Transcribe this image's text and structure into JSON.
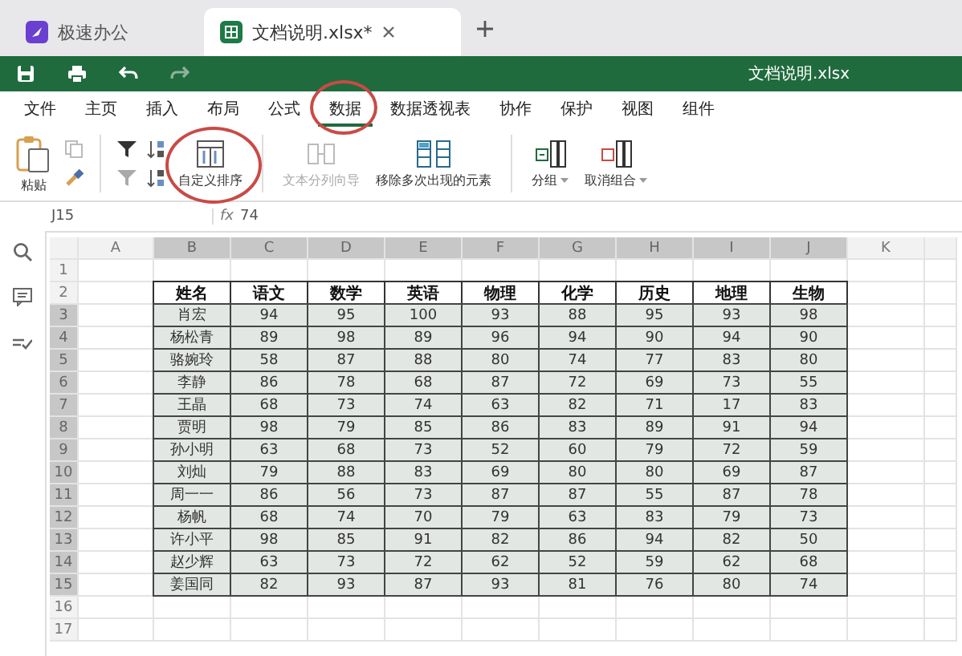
{
  "tabs": [
    {
      "label": "极速办公",
      "kind": "home",
      "selected": false
    },
    {
      "label": "文档说明.xlsx*",
      "kind": "sheet",
      "selected": true
    }
  ],
  "toolbar": {
    "title": "文档说明.xlsx"
  },
  "menu": [
    {
      "label": "文件",
      "selected": false,
      "circled": false
    },
    {
      "label": "主页",
      "selected": false,
      "circled": false
    },
    {
      "label": "插入",
      "selected": false,
      "circled": false
    },
    {
      "label": "布局",
      "selected": false,
      "circled": false
    },
    {
      "label": "公式",
      "selected": false,
      "circled": false
    },
    {
      "label": "数据",
      "selected": true,
      "circled": true
    },
    {
      "label": "数据透视表",
      "selected": false,
      "circled": false
    },
    {
      "label": "协作",
      "selected": false,
      "circled": false
    },
    {
      "label": "保护",
      "selected": false,
      "circled": false
    },
    {
      "label": "视图",
      "selected": false,
      "circled": false
    },
    {
      "label": "组件",
      "selected": false,
      "circled": false
    }
  ],
  "ribbon": {
    "paste": "粘贴",
    "custom_sort": {
      "label": "自定义排序",
      "circled": true
    },
    "text_to_columns": {
      "label": "文本分列向导",
      "disabled": true
    },
    "remove_duplicates": {
      "label": "移除多次出现的元素",
      "disabled": false
    },
    "group": "分组",
    "ungroup": "取消组合"
  },
  "formula_bar": {
    "name_box": "J15",
    "fx": "fx",
    "value": "74"
  },
  "sheet": {
    "columns": [
      {
        "label": "A",
        "selected": false
      },
      {
        "label": "B",
        "selected": true
      },
      {
        "label": "C",
        "selected": true
      },
      {
        "label": "D",
        "selected": true
      },
      {
        "label": "E",
        "selected": true
      },
      {
        "label": "F",
        "selected": true
      },
      {
        "label": "G",
        "selected": true
      },
      {
        "label": "H",
        "selected": true
      },
      {
        "label": "I",
        "selected": true
      },
      {
        "label": "J",
        "selected": true
      },
      {
        "label": "K",
        "selected": false
      }
    ],
    "rows": [
      {
        "label": "1",
        "selected": false
      },
      {
        "label": "2",
        "selected": false
      },
      {
        "label": "3",
        "selected": true
      },
      {
        "label": "4",
        "selected": true
      },
      {
        "label": "5",
        "selected": true
      },
      {
        "label": "6",
        "selected": true
      },
      {
        "label": "7",
        "selected": true
      },
      {
        "label": "8",
        "selected": true
      },
      {
        "label": "9",
        "selected": true
      },
      {
        "label": "10",
        "selected": true
      },
      {
        "label": "11",
        "selected": true
      },
      {
        "label": "12",
        "selected": true
      },
      {
        "label": "13",
        "selected": true
      },
      {
        "label": "14",
        "selected": true
      },
      {
        "label": "15",
        "selected": true
      },
      {
        "label": "16",
        "selected": false
      },
      {
        "label": "17",
        "selected": false
      }
    ],
    "table_header": [
      "姓名",
      "语文",
      "数学",
      "英语",
      "物理",
      "化学",
      "历史",
      "地理",
      "生物"
    ],
    "table_rows": [
      [
        "肖宏",
        "94",
        "95",
        "100",
        "93",
        "88",
        "95",
        "93",
        "98"
      ],
      [
        "杨松青",
        "89",
        "98",
        "89",
        "96",
        "94",
        "90",
        "94",
        "90"
      ],
      [
        "骆婉玲",
        "58",
        "87",
        "88",
        "80",
        "74",
        "77",
        "83",
        "80"
      ],
      [
        "李静",
        "86",
        "78",
        "68",
        "87",
        "72",
        "69",
        "73",
        "55"
      ],
      [
        "王晶",
        "68",
        "73",
        "74",
        "63",
        "82",
        "71",
        "17",
        "83"
      ],
      [
        "贾明",
        "98",
        "79",
        "85",
        "86",
        "83",
        "89",
        "91",
        "94"
      ],
      [
        "孙小明",
        "63",
        "68",
        "73",
        "52",
        "60",
        "79",
        "72",
        "59"
      ],
      [
        "刘灿",
        "79",
        "88",
        "83",
        "69",
        "80",
        "80",
        "69",
        "87"
      ],
      [
        "周一一",
        "86",
        "56",
        "73",
        "87",
        "87",
        "55",
        "87",
        "78"
      ],
      [
        "杨帆",
        "68",
        "74",
        "70",
        "79",
        "63",
        "83",
        "79",
        "73"
      ],
      [
        "许小平",
        "98",
        "85",
        "91",
        "82",
        "86",
        "94",
        "82",
        "50"
      ],
      [
        "赵少辉",
        "63",
        "73",
        "72",
        "62",
        "52",
        "59",
        "62",
        "68"
      ],
      [
        "姜国同",
        "82",
        "93",
        "87",
        "93",
        "81",
        "76",
        "80",
        "74"
      ]
    ]
  }
}
